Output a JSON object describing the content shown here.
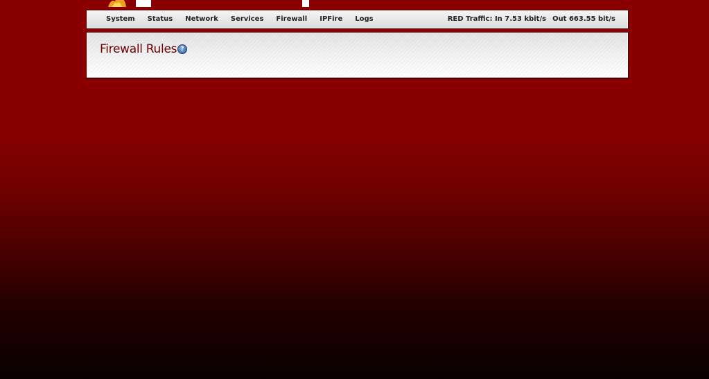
{
  "colors": {
    "background_top": "#8a0000",
    "background_bottom": "#080000",
    "title": "#6b0000",
    "nav_text": "#222222"
  },
  "nav": {
    "items": [
      {
        "label": "System"
      },
      {
        "label": "Status"
      },
      {
        "label": "Network"
      },
      {
        "label": "Services"
      },
      {
        "label": "Firewall"
      },
      {
        "label": "IPFire"
      },
      {
        "label": "Logs"
      }
    ],
    "traffic": {
      "in": "RED Traffic: In 7.53 kbit/s",
      "out": "Out 663.55 bit/s"
    }
  },
  "main": {
    "title": "Firewall Rules",
    "help_icon": "help-icon",
    "help_glyph": "?"
  }
}
